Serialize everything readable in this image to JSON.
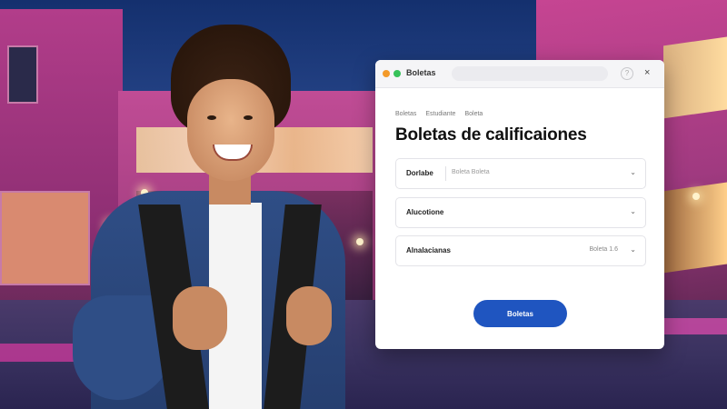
{
  "window": {
    "app_title": "Boletas",
    "help_glyph": "?",
    "close_glyph": "×"
  },
  "breadcrumb": [
    "Boletas",
    "Estudiante",
    "Boleta"
  ],
  "page": {
    "title": "Boletas de calificaiones"
  },
  "fields": [
    {
      "label": "Dorlabe",
      "value": "Boleta Boleta",
      "meta": "",
      "control": "⌄"
    },
    {
      "label": "Alucotione",
      "value": "",
      "meta": "",
      "control": "⌄"
    },
    {
      "label": "Alnalacianas",
      "value": "",
      "meta": "Boleta 1.6",
      "control": "⌄"
    }
  ],
  "actions": {
    "primary_label": "Boletas"
  },
  "colors": {
    "accent": "#1f55c0",
    "dot_orange": "#f39a2a",
    "dot_green": "#37c25a"
  }
}
